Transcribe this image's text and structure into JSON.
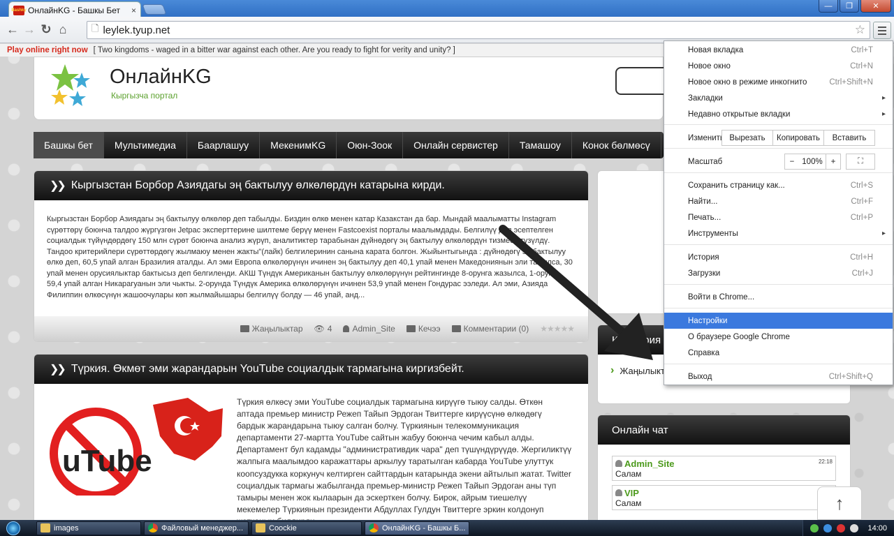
{
  "browser": {
    "tab_title": "ОнлайнKG - Башкы Бет",
    "tab_close": "×",
    "tab_favicon_text": "Bashky",
    "url": "leylek.tyup.net",
    "window_controls": {
      "minimize": "—",
      "maximize": "❐",
      "close": "✕"
    },
    "nav": {
      "back": "←",
      "forward": "→",
      "reload": "↻",
      "home": "⌂",
      "star": "☆"
    }
  },
  "adbar": {
    "link": "Play online right now",
    "text": "[ Two kingdoms - waged in a bitter war against each other. Are you ready to fight for verity and unity? ]"
  },
  "site": {
    "name": "ОнлайнKG",
    "subtitle": "Кыргызча портал"
  },
  "main_nav": [
    "Башкы бет",
    "Мультимедиа",
    "Баарлашуу",
    "МекенимKG",
    "Оюн-Зоок",
    "Онлайн сервистер",
    "Тамашоу",
    "Конок бөлмөсү"
  ],
  "posts": [
    {
      "title": "Кыргызстан Борбор Азиядагы эң бактылуу өлкөлөрдүн катарына кирди.",
      "body": "Кыргызстан Борбор Азиядагы эң бактылуу өлкөлөр деп табылды. Биздин өлкө менен катар Казакстан да бар. Мындай маалыматты Instagram сүрөттөрү боюнча талдоо жүргүзгөн Jetpac эксперттерине шилтеме берүү менен Fastcoexist порталы маалымдады. Белгилүү деп эсептелген социалдык түйүндөрдөгү 150 млн сүрөт боюнча анализ жүрүп, аналитиктер тарабынан дүйнөдөгү эң бактылуу өлкөлөрдүн тизмеси түзүлдү. Тандоо критерийлери сүрөттөрдөгү жылмаюу менен жакты\"(лайк) белгилеринин санына карата болгон. Жыйынтыгында : дүйнөдөгү эң бактылуу өлкө деп, 60,5 упай алган Бразилия аталды. Ал эми Европа өлкөлөрүнүн ичинен эң бактылуу деп 40,1 упай менен Македониянын эли табылса, 30 упай менен орусиялыктар бактысыз деп белгиленди. АКШ Түндүк Американын бактылуу өлкөлөрүнүн рейтингинде 8-орунга жазылса, 1-орунга 59,4 упай алган Никарагуанын эли чыкты. 2-орунда Түндүк Америка өлкөлөрүнүн ичинен 53,9 упай менен Гондурас ээледи. Ал эми, Азияда Филиппин өлкөсүнүн жашоочулары көп жылмайышары белгилүү болду — 46 упай, анд...",
      "category": "Жаңылыктар",
      "views": "4",
      "author": "Admin_Site",
      "date": "Кечээ",
      "comments": "Комментарии (0)",
      "rating": "★★★★★"
    },
    {
      "title": "Түркия. Өкмөт эми жарандарын YouTube социалдык тармагына киргизбейт.",
      "image_text": "uTube",
      "body": "Түркия өлкөсү эми YouTube социалдык тармагына кирүүгө тыюу салды. Өткөн аптада премьер министр Режеп Тайып Эрдоган Твиттерге кирүүсүнө өлкөдөгү бардык жарандарына тыюу салган болчу. Түркиянын телекоммуникация департаменти 27-мартта YouTube сайтын жабуу боюнча чечим кабыл алды. Департамент бул кадамды \"административдик чара\" деп түшүндүрүүдө. Жергиликтүү жалпыга маалымдоо каражаттары аркылуу таратылган кабарда YouTube улуттук коопсуздукка коркунуч келтирген сайттардын катарында экени айтылып жатат. Twitter социалдык тармагы жабылганда премьер-министр Режеп Тайып Эрдоган аны түп тамыры менен жок кылаарын да эскерткен болчу. Бирок, айрым тиешелүү мекемелер Түркиянын президенти Абдуллах Гулдун Твиттерге эркин колдонуп жатканын билдирди..."
    }
  ],
  "sidebar": {
    "categories_title": "Категория",
    "categories": [
      {
        "label": "Жаңылыктар",
        "marker": "›"
      }
    ],
    "chat_title": "Онлайн чат",
    "chat": [
      {
        "user": "Admin_Site",
        "text": "Салам",
        "time": "22:18"
      },
      {
        "user": "VIP",
        "text": "Салам",
        "time": ""
      }
    ],
    "scroll_top": "↑"
  },
  "chrome_menu": {
    "items": [
      {
        "label": "Новая вкладка",
        "shortcut": "Ctrl+T"
      },
      {
        "label": "Новое окно",
        "shortcut": "Ctrl+N"
      },
      {
        "label": "Новое окно в режиме инкогнито",
        "shortcut": "Ctrl+Shift+N"
      },
      {
        "label": "Закладки",
        "shortcut": "",
        "submenu": "▸"
      },
      {
        "label": "Недавно открытые вкладки",
        "shortcut": "",
        "submenu": "▸"
      }
    ],
    "edit": {
      "label": "Изменить",
      "cut": "Вырезать",
      "copy": "Копировать",
      "paste": "Вставить"
    },
    "zoom": {
      "label": "Масштаб",
      "minus": "−",
      "value": "100%",
      "plus": "+",
      "fullscreen": "⛶"
    },
    "items2": [
      {
        "label": "Сохранить страницу как...",
        "shortcut": "Ctrl+S"
      },
      {
        "label": "Найти...",
        "shortcut": "Ctrl+F"
      },
      {
        "label": "Печать...",
        "shortcut": "Ctrl+P"
      },
      {
        "label": "Инструменты",
        "shortcut": "",
        "submenu": "▸"
      }
    ],
    "items3": [
      {
        "label": "История",
        "shortcut": "Ctrl+H"
      },
      {
        "label": "Загрузки",
        "shortcut": "Ctrl+J"
      }
    ],
    "signin": "Войти в Chrome...",
    "items4": [
      {
        "label": "Настройки",
        "shortcut": ""
      },
      {
        "label": "О браузере Google Chrome",
        "shortcut": ""
      },
      {
        "label": "Справка",
        "shortcut": ""
      }
    ],
    "exit": {
      "label": "Выход",
      "shortcut": "Ctrl+Shift+Q"
    }
  },
  "taskbar": {
    "items": [
      {
        "label": "images",
        "icon": "folder"
      },
      {
        "label": "Файловый менеджер...",
        "icon": "chrome"
      },
      {
        "label": "Coockie",
        "icon": "folder"
      },
      {
        "label": "ОнлайнKG - Башкы Б...",
        "icon": "chrome"
      }
    ],
    "clock": "14:00"
  },
  "colors": {
    "accent_green": "#5aa02c",
    "highlight_blue": "#3b79de",
    "ad_red": "#d6291c"
  }
}
